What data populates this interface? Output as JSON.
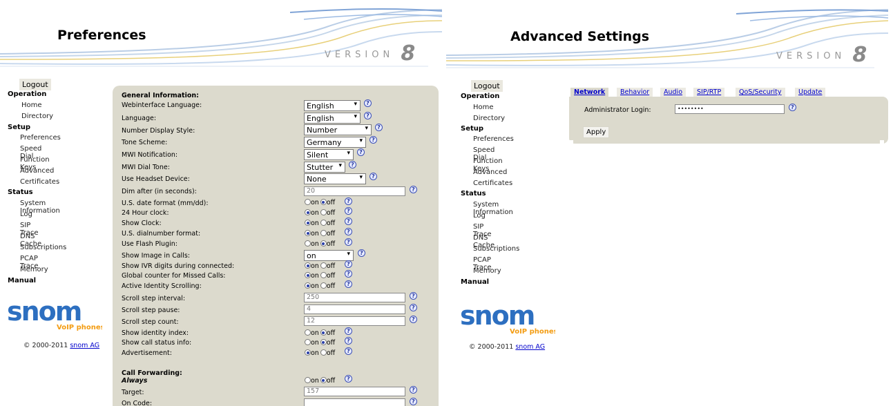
{
  "left": {
    "title": "Preferences",
    "version_text": "VERSION",
    "version_num": "8",
    "logout": "Logout",
    "nav": {
      "operation": "Operation",
      "home": "Home",
      "directory": "Directory",
      "setup": "Setup",
      "preferences": "Preferences",
      "speed_dial": "Speed Dial",
      "function_keys": "Function Keys",
      "advanced": "Advanced",
      "certificates": "Certificates",
      "status": "Status",
      "system_information": "System Information",
      "log": "Log",
      "sip_trace": "SIP Trace",
      "dns_cache": "DNS Cache",
      "subscriptions": "Subscriptions",
      "pcap_trace": "PCAP Trace",
      "memory": "Memory",
      "manual": "Manual"
    },
    "logo": {
      "brand": "snom",
      "tagline": "VoIP phones"
    },
    "copyright": {
      "text": "© 2000-2011",
      "link": "snom AG"
    },
    "general": {
      "title": "General Information:",
      "webinterface_language": {
        "label": "Webinterface Language:",
        "value": "English"
      },
      "language": {
        "label": "Language:",
        "value": "English"
      },
      "number_display_style": {
        "label": "Number Display Style:",
        "value": "Number"
      },
      "tone_scheme": {
        "label": "Tone Scheme:",
        "value": "Germany"
      },
      "mwi_notification": {
        "label": "MWI Notification:",
        "value": "Silent"
      },
      "mwi_dial_tone": {
        "label": "MWI Dial Tone:",
        "value": "Stutter"
      },
      "use_headset_device": {
        "label": "Use Headset Device:",
        "value": "None"
      },
      "dim_after": {
        "label": "Dim after (in seconds):",
        "value": "20"
      },
      "us_date_format": {
        "label": "U.S. date format (mm/dd):",
        "state": "off"
      },
      "hour24_clock": {
        "label": "24 Hour clock:",
        "state": "on"
      },
      "show_clock": {
        "label": "Show Clock:",
        "state": "on"
      },
      "us_dialnumber_format": {
        "label": "U.S. dialnumber format:",
        "state": "on"
      },
      "use_flash_plugin": {
        "label": "Use Flash Plugin:",
        "state": "off"
      },
      "show_image_in_calls": {
        "label": "Show Image in Calls:",
        "value": "on"
      },
      "show_ivr_digits": {
        "label": "Show IVR digits during connected:",
        "state": "on"
      },
      "global_counter_missed": {
        "label": "Global counter for Missed Calls:",
        "state": "on"
      },
      "active_identity_scrolling": {
        "label": "Active Identity Scrolling:",
        "state": "on"
      },
      "scroll_step_interval": {
        "label": "Scroll step interval:",
        "value": "250"
      },
      "scroll_step_pause": {
        "label": "Scroll step pause:",
        "value": "4"
      },
      "scroll_step_count": {
        "label": "Scroll step count:",
        "value": "12"
      },
      "show_identity_index": {
        "label": "Show identity index:",
        "state": "off"
      },
      "show_call_status_info": {
        "label": "Show call status info:",
        "state": "off"
      },
      "advertisement": {
        "label": "Advertisement:",
        "state": "on"
      }
    },
    "forwarding": {
      "title": "Call Forwarding:",
      "always": {
        "label": "Always",
        "state": "off"
      },
      "target": {
        "label": "Target:",
        "value": "157"
      },
      "on_code": {
        "label": "On Code:",
        "value": ""
      }
    },
    "radio_on": "on",
    "radio_off": "off",
    "help_glyph": "?",
    "select_arrow": "▾"
  },
  "right": {
    "title": "Advanced Settings",
    "version_text": "VERSION",
    "version_num": "8",
    "logout": "Logout",
    "nav": {
      "operation": "Operation",
      "home": "Home",
      "directory": "Directory",
      "setup": "Setup",
      "preferences": "Preferences",
      "speed_dial": "Speed Dial",
      "function_keys": "Function Keys",
      "advanced": "Advanced",
      "certificates": "Certificates",
      "status": "Status",
      "system_information": "System Information",
      "log": "Log",
      "sip_trace": "SIP Trace",
      "dns_cache": "DNS Cache",
      "subscriptions": "Subscriptions",
      "pcap_trace": "PCAP Trace",
      "memory": "Memory",
      "manual": "Manual"
    },
    "logo": {
      "brand": "snom",
      "tagline": "VoIP phones"
    },
    "copyright": {
      "text": "© 2000-2011",
      "link": "snom AG"
    },
    "tabs": [
      "Network",
      "Behavior",
      "Audio",
      "SIP/RTP",
      "QoS/Security",
      "Update"
    ],
    "admin_login": {
      "label": "Administrator Login:",
      "value": "••••••••"
    },
    "apply": "Apply"
  },
  "colors": {
    "content_bg": "#dcdacd",
    "link": "#0000cc",
    "logo_blue": "#2d6fc0",
    "logo_orange": "#f39c12"
  }
}
